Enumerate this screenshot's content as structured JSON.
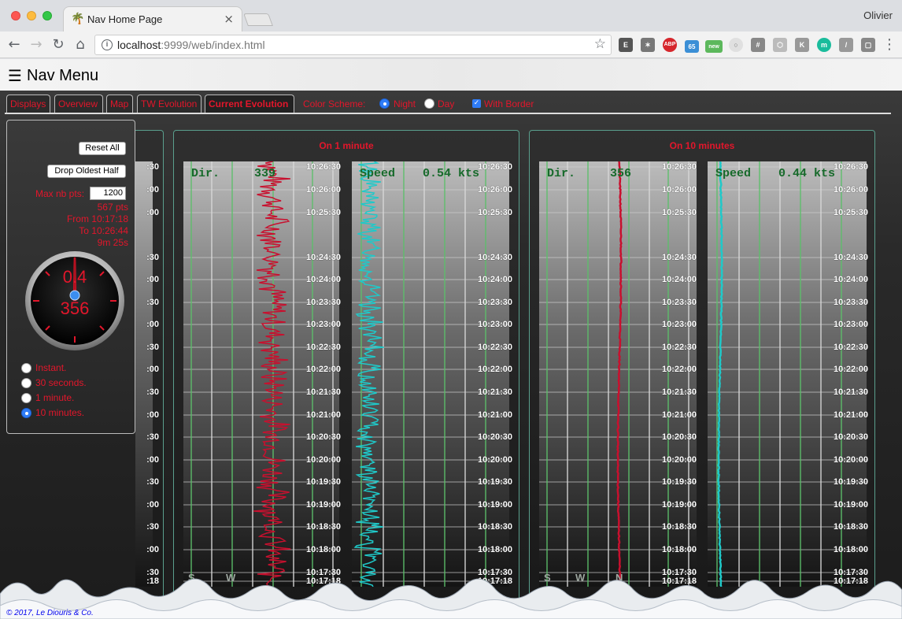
{
  "browser": {
    "tab_title": "Nav Home Page",
    "tab_favicon": "palm-tree-icon",
    "profile_name": "Olivier",
    "url_host": "localhost",
    "url_path": ":9999/web/index.html",
    "badge_count": "65",
    "badge_new": "new",
    "ext_abp": "ABP"
  },
  "page": {
    "menu_icon": "hamburger-icon",
    "title": "Nav Menu",
    "copyright": "© 2017, Le Diouris & Co."
  },
  "tabs": [
    {
      "label": "Displays"
    },
    {
      "label": "Overview"
    },
    {
      "label": "Map"
    },
    {
      "label": "TW Evolution"
    },
    {
      "label": "Current Evolution"
    }
  ],
  "color_scheme": {
    "label": "Color Scheme:",
    "night": "Night",
    "day": "Day",
    "selected": "Night",
    "border_label": "With Border",
    "border_checked": true
  },
  "left": {
    "reset_all": "Reset All",
    "drop_oldest": "Drop Oldest Half",
    "max_label": "Max nb pts:",
    "max_value": "1200",
    "pts": "567 pts",
    "from": "From 10:17:18",
    "to": "To 10:26:44",
    "duration": "9m 25s",
    "gauge_speed": "0.4",
    "gauge_dir": "356",
    "options": [
      "Instant.",
      "30 seconds.",
      "1 minute.",
      "10 minutes."
    ],
    "selected_option": 3
  },
  "panels": [
    {
      "title": "On 1 minute",
      "dir_label": "Dir.",
      "dir_value": "339",
      "speed_label": "Speed",
      "speed_value": "0.54 kts"
    },
    {
      "title": "On 10 minutes",
      "dir_label": "Dir.",
      "dir_value": "356",
      "speed_label": "Speed",
      "speed_value": "0.44 kts"
    }
  ],
  "time_ticks": [
    "10:26:30",
    "10:26:00",
    "10:25:30",
    "10:24:30",
    "10:24:00",
    "10:23:30",
    "10:23:00",
    "10:22:30",
    "10:22:00",
    "10:21:30",
    "10:21:00",
    "10:20:30",
    "10:20:00",
    "10:19:30",
    "10:19:00",
    "10:18:30",
    "10:18:00",
    "10:17:30",
    "10:17:18"
  ],
  "partial_ticks": [
    ":30",
    ":00",
    ":00",
    ":30",
    ":00",
    ":30",
    ":00",
    ":30",
    ":00",
    ":30",
    ":00",
    ":30",
    ":00",
    ":30",
    ":00",
    ":30",
    ":00",
    ":30",
    ":18"
  ],
  "compass": {
    "s": "S",
    "w": "W",
    "n": "N"
  },
  "colors": {
    "accent": "#e3162b",
    "dir_trace": "#c8102e",
    "speed_trace": "#1fc9c9",
    "panel_border": "#5a9f8d",
    "grid_green": "#5cbf6a"
  }
}
